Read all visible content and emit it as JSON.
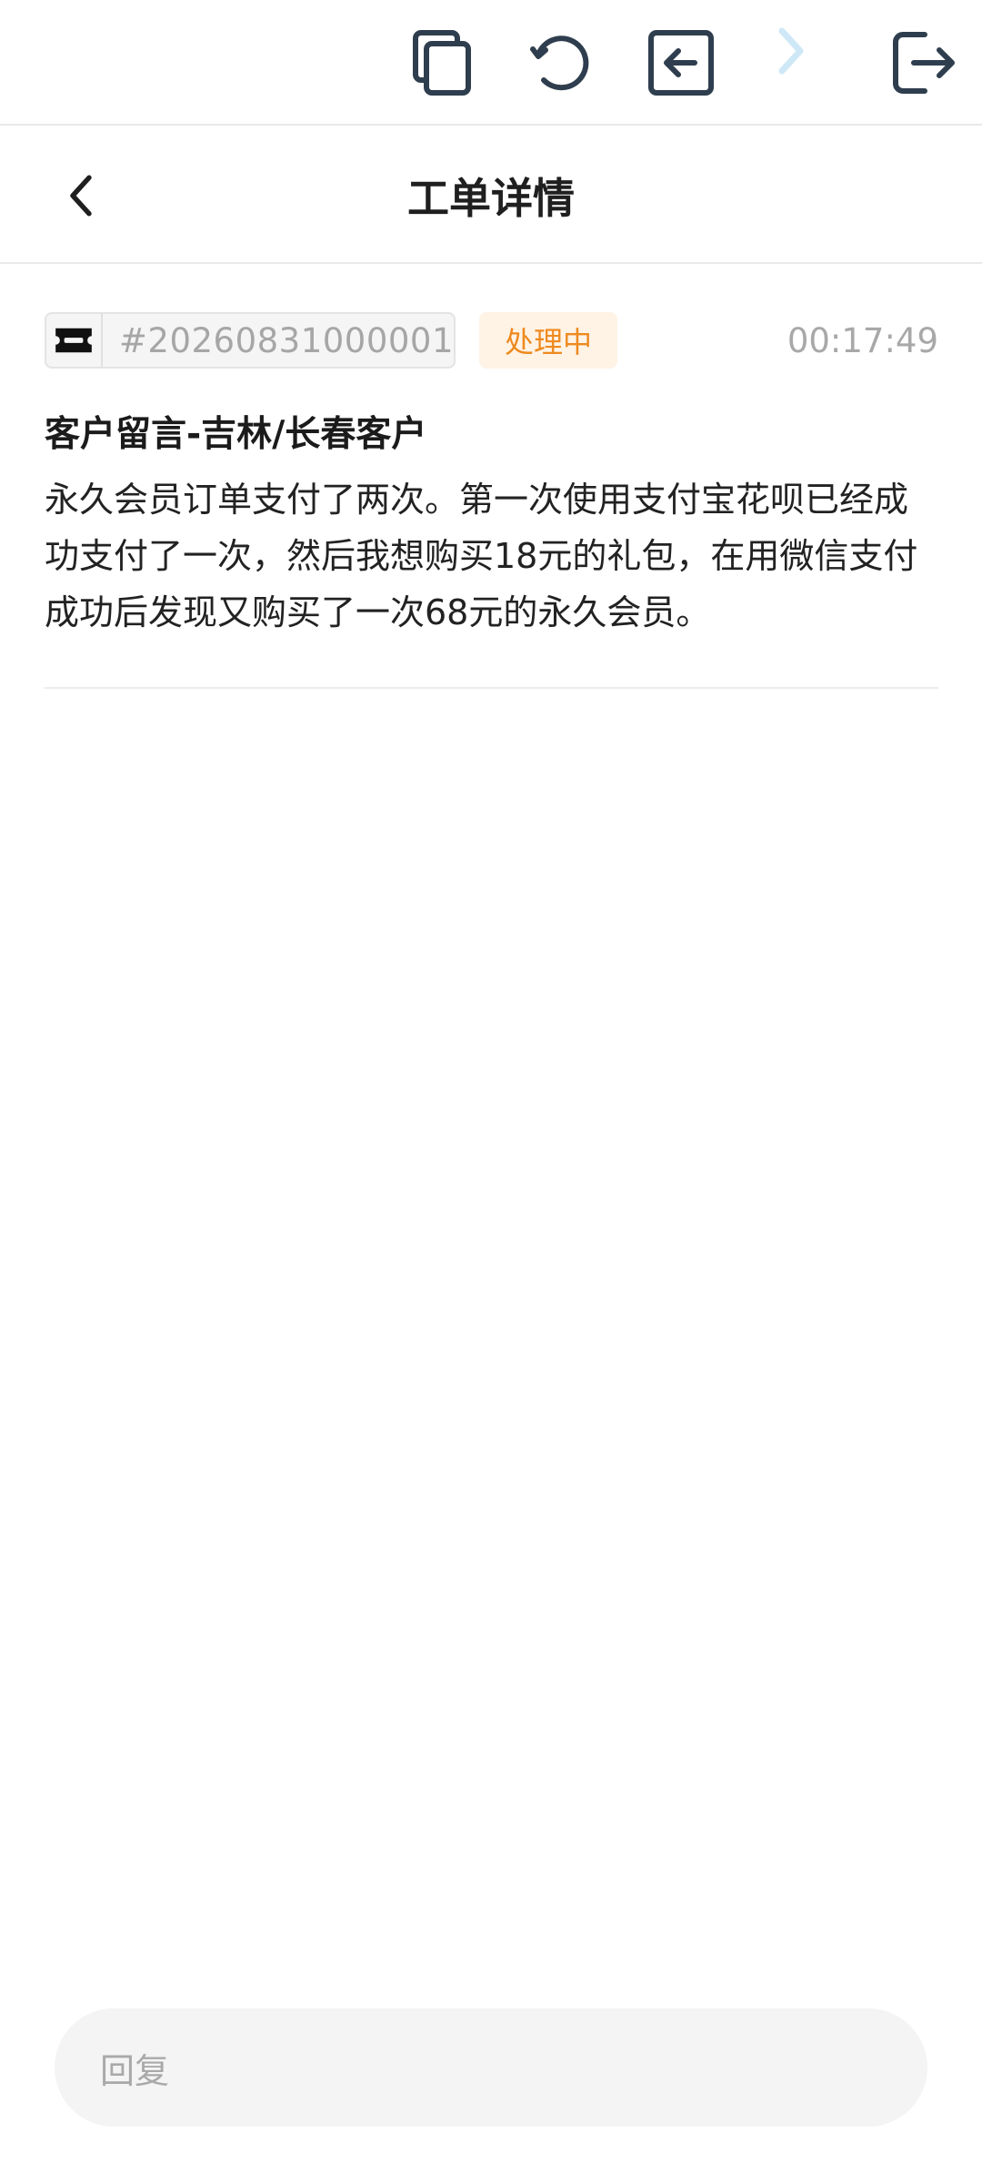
{
  "toolbar": {
    "buttons": [
      {
        "icon": "copy-icon",
        "enabled": true
      },
      {
        "icon": "refresh-icon",
        "enabled": true
      },
      {
        "icon": "back-arrow-box-icon",
        "enabled": true
      },
      {
        "icon": "chevron-right-icon",
        "enabled": false
      },
      {
        "icon": "exit-icon",
        "enabled": true
      }
    ],
    "icon_color": "#2f3e4e",
    "disabled_color": "#cfe8f7"
  },
  "nav": {
    "back_icon": "chevron-left-icon",
    "title": "工单详情"
  },
  "ticket": {
    "icon": "ticket-icon",
    "id": "#20260831000001",
    "status": "处理中",
    "time": "00:17:49"
  },
  "message": {
    "title": "客户留言-吉林/长春客户",
    "body": "永久会员订单支付了两次。第一次使用支付宝花呗已经成功支付了一次，然后我想购买18元的礼包，在用微信支付成功后发现又购买了一次68元的永久会员。"
  },
  "reply": {
    "placeholder": "回复"
  },
  "colors": {
    "status_text": "#ee8a1f",
    "status_bg": "#fff3e6",
    "muted_text": "#a6a6a6"
  }
}
